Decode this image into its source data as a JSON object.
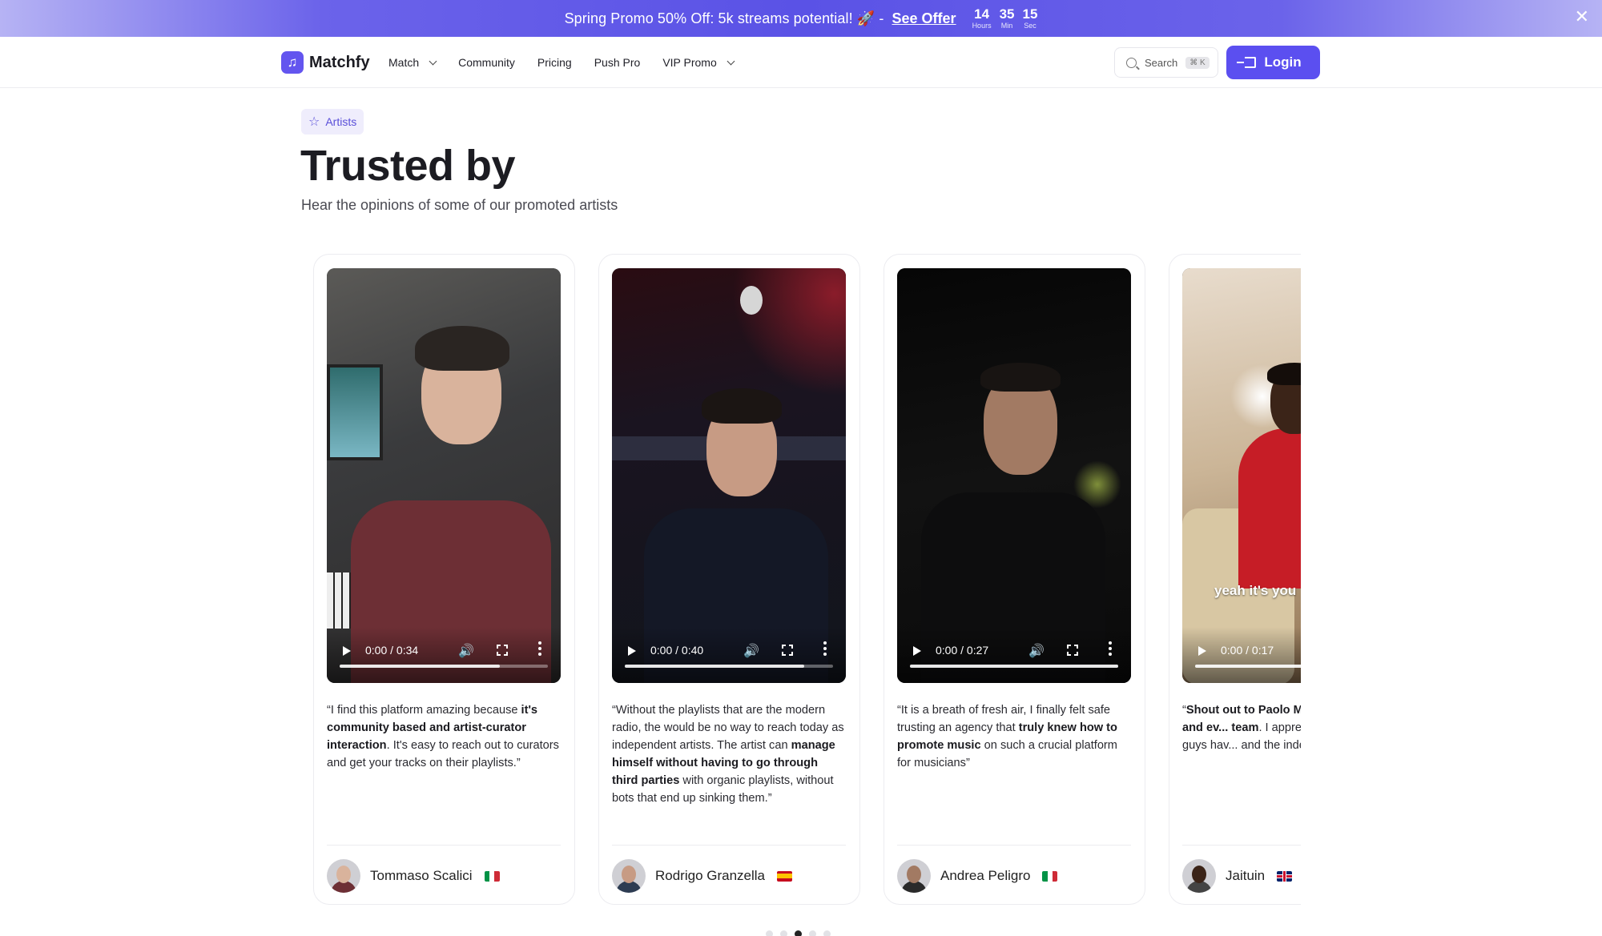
{
  "promo": {
    "text": "Spring Promo 50% Off: 5k streams potential! 🚀 -",
    "link": "See Offer",
    "countdown": [
      {
        "value": "14",
        "label": "Hours"
      },
      {
        "value": "35",
        "label": "Min"
      },
      {
        "value": "15",
        "label": "Sec"
      }
    ],
    "close": "✕"
  },
  "nav": {
    "brand": "Matchfy",
    "items": [
      "Match",
      "Community",
      "Pricing",
      "Push Pro",
      "VIP Promo"
    ],
    "search_label": "Search",
    "search_shortcut": "⌘ K",
    "login": "Login"
  },
  "section": {
    "badge": "Artists",
    "title": "Trusted by",
    "subtitle": "Hear the opinions of some of our promoted artists"
  },
  "testimonials": [
    {
      "time": "0:00 / 0:34",
      "progress": 0.77,
      "quote_parts": [
        "“I find this platform amazing because ",
        "it's community based and artist-curator interaction",
        ". It's easy to reach out to curators and get your tracks on their playlists.”"
      ],
      "name": "Tommaso Scalici",
      "flag": "it"
    },
    {
      "time": "0:00 / 0:40",
      "progress": 0.86,
      "quote_parts": [
        "“Without the playlists that are the modern radio, the would be no way to reach today as independent artists. The artist can ",
        "manage himself without having to go through third parties",
        " with organic playlists, without bots that end up sinking them.”"
      ],
      "name": "Rodrigo Granzella",
      "flag": "es"
    },
    {
      "time": "0:00 / 0:27",
      "progress": 1.0,
      "quote_parts": [
        "“It is a breath of fresh air, I finally felt safe trusting an agency that ",
        "truly knew how to promote music",
        " on such a crucial platform for musicians”"
      ],
      "name": "Andrea Peligro",
      "flag": "it"
    },
    {
      "time": "0:00 / 0:17",
      "progress": 1.0,
      "caption": "yeah it's you",
      "quote_parts": [
        "“",
        "Shout out to Paolo M... out to Alessia and ev... team",
        ". I appreciate yo... support you guys hav... and the independent"
      ],
      "name": "Jaituin",
      "flag": "gb"
    }
  ],
  "pager": {
    "count": 5,
    "active": 2
  },
  "colors": {
    "brand": "#5b4ff0",
    "badge_bg": "#efedfc",
    "banner": "#5a52e6"
  }
}
